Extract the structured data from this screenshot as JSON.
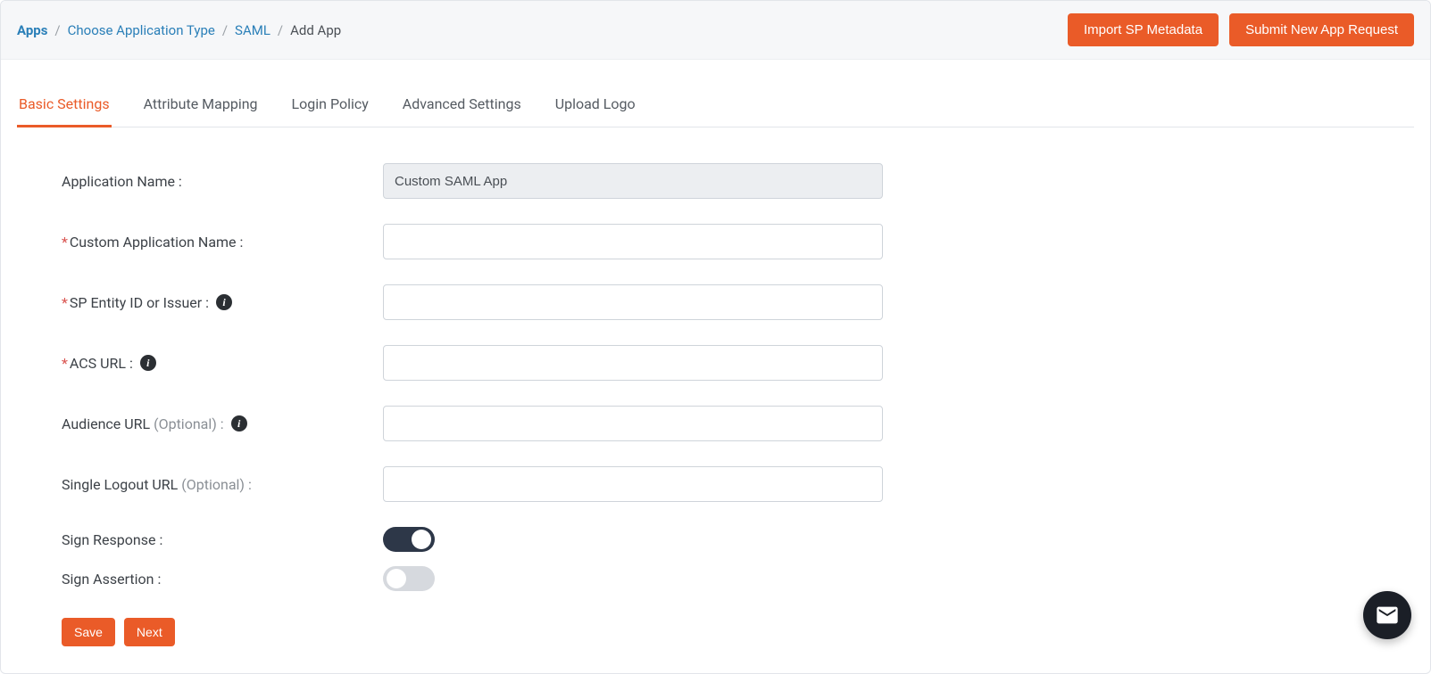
{
  "breadcrumb": {
    "apps": "Apps",
    "choose_type": "Choose Application Type",
    "saml": "SAML",
    "current": "Add App"
  },
  "top_actions": {
    "import_metadata": "Import SP Metadata",
    "submit_request": "Submit New App Request"
  },
  "tabs": {
    "basic": "Basic Settings",
    "attribute": "Attribute Mapping",
    "login_policy": "Login Policy",
    "advanced": "Advanced Settings",
    "upload_logo": "Upload Logo"
  },
  "form": {
    "app_name_label": "Application Name :",
    "app_name_value": "Custom SAML App",
    "custom_app_name_label": "Custom Application Name :",
    "custom_app_name_value": "",
    "sp_entity_label": "SP Entity ID or Issuer :",
    "sp_entity_value": "",
    "acs_url_label": "ACS URL :",
    "acs_url_value": "",
    "audience_label": "Audience URL",
    "audience_optional": "(Optional) :",
    "audience_value": "",
    "slo_label": "Single Logout URL",
    "slo_optional": "(Optional) :",
    "slo_value": "",
    "sign_response_label": "Sign Response :",
    "sign_response_on": true,
    "sign_assertion_label": "Sign Assertion :",
    "sign_assertion_on": false
  },
  "footer": {
    "save": "Save",
    "next": "Next"
  },
  "icons": {
    "info": "i"
  }
}
